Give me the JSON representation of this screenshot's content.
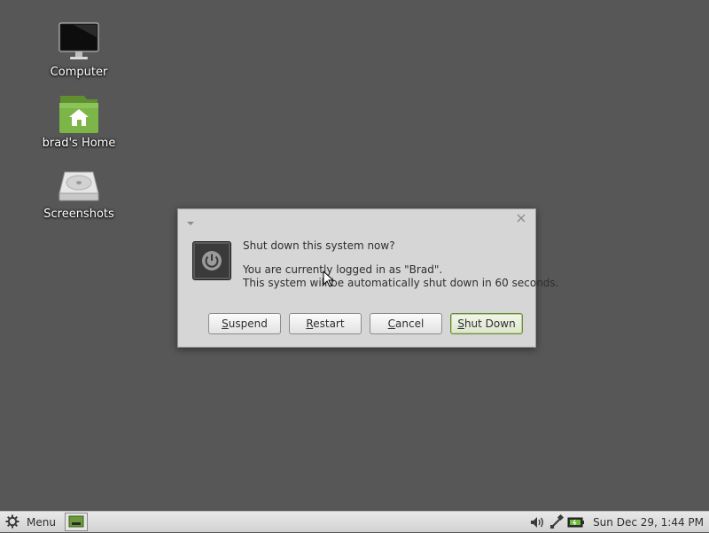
{
  "desktop": {
    "icons": [
      {
        "label": "Computer",
        "icon": "monitor-icon"
      },
      {
        "label": "brad's Home",
        "icon": "home-folder-icon"
      },
      {
        "label": "Screenshots",
        "icon": "drive-icon"
      }
    ]
  },
  "dialog": {
    "question": "Shut down this system now?",
    "line1": "You are currently logged in as \"Brad\".",
    "line2": "This system will be automatically shut down in 60 seconds.",
    "buttons": {
      "suspend": {
        "accel": "S",
        "rest": "uspend"
      },
      "restart": {
        "accel": "R",
        "rest": "estart"
      },
      "cancel": {
        "accel": "C",
        "rest": "ancel"
      },
      "shutdown": {
        "accel": "S",
        "rest": "hut Down"
      }
    }
  },
  "panel": {
    "menu_label": "Menu",
    "clock": "Sun Dec 29,  1:44 PM",
    "tray_icons": [
      "volume-icon",
      "network-icon",
      "battery-icon"
    ]
  },
  "colors": {
    "desktop_bg": "#575757",
    "accent_green": "#6a9a3a"
  }
}
